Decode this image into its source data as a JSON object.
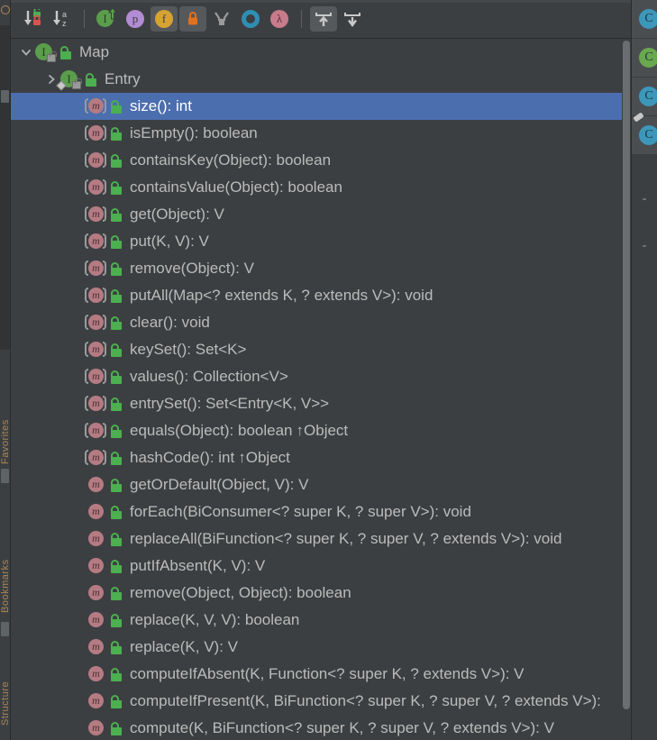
{
  "window": {
    "title": "Structure",
    "background": "#3c3f41",
    "selection_color": "#4b6eaf",
    "text_color": "#bbbbbb",
    "inherited_text_color": "#808080"
  },
  "toolbar": {
    "items": [
      {
        "name": "sort-by-visibility-button",
        "label": "Sort by Visibility",
        "icon": "sort-down-lock-icon",
        "active": false
      },
      {
        "name": "sort-alphabetically-button",
        "label": "Sort Alphabetically",
        "icon": "sort-down-az-icon",
        "active": false
      },
      {
        "separator": true
      },
      {
        "name": "show-inherited-button",
        "label": "Show Inherited",
        "icon": "interface-up-arrow-icon",
        "active": false,
        "color": "#5a9e4b"
      },
      {
        "name": "show-properties-button",
        "label": "Show Properties",
        "icon": "property-p-icon",
        "active": false,
        "color": "#b28cd4"
      },
      {
        "name": "show-fields-button",
        "label": "Show Fields",
        "icon": "field-f-icon",
        "active": true,
        "color": "#d6a332"
      },
      {
        "name": "show-non-public-button",
        "label": "Show Non-Public",
        "icon": "orange-padlock-icon",
        "active": true,
        "color": "#e2711d"
      },
      {
        "name": "show-anonymous-button",
        "label": "Show Anonymous Classes",
        "icon": "anonymous-y-icon",
        "active": false,
        "color": "#9a9a9a"
      },
      {
        "name": "show-interfaces-button",
        "label": "Show Interfaces",
        "icon": "ring-o-icon",
        "active": false,
        "color": "#2f8fb3"
      },
      {
        "name": "show-lambdas-button",
        "label": "Show Lambdas",
        "icon": "lambda-icon",
        "active": false,
        "color": "#c77b8b"
      },
      {
        "separator": true
      },
      {
        "name": "expand-all-button",
        "label": "Expand All",
        "icon": "expand-all-icon",
        "active": true
      },
      {
        "name": "collapse-all-button",
        "label": "Collapse All",
        "icon": "collapse-all-icon",
        "active": false
      }
    ]
  },
  "tree": {
    "rows": [
      {
        "name": "tree-node-map",
        "indent": 0,
        "arrow": "down",
        "icon": "interface-icon",
        "text": "Map",
        "selected": false
      },
      {
        "name": "tree-node-entry",
        "indent": 1,
        "arrow": "right",
        "icon": "interface-inner-icon",
        "text": "Entry",
        "selected": false
      },
      {
        "name": "tree-node-size",
        "indent": 2,
        "arrow": "none",
        "icon": "abstract-method-icon",
        "text": "size(): int",
        "selected": true
      },
      {
        "name": "tree-node-isempty",
        "indent": 2,
        "arrow": "none",
        "icon": "abstract-method-icon",
        "text": "isEmpty(): boolean",
        "selected": false
      },
      {
        "name": "tree-node-containskey",
        "indent": 2,
        "arrow": "none",
        "icon": "abstract-method-icon",
        "text": "containsKey(Object): boolean",
        "selected": false
      },
      {
        "name": "tree-node-containsvalue",
        "indent": 2,
        "arrow": "none",
        "icon": "abstract-method-icon",
        "text": "containsValue(Object): boolean",
        "selected": false
      },
      {
        "name": "tree-node-get",
        "indent": 2,
        "arrow": "none",
        "icon": "abstract-method-icon",
        "text": "get(Object): V",
        "selected": false
      },
      {
        "name": "tree-node-put",
        "indent": 2,
        "arrow": "none",
        "icon": "abstract-method-icon",
        "text": "put(K, V): V",
        "selected": false
      },
      {
        "name": "tree-node-remove",
        "indent": 2,
        "arrow": "none",
        "icon": "abstract-method-icon",
        "text": "remove(Object): V",
        "selected": false
      },
      {
        "name": "tree-node-putall",
        "indent": 2,
        "arrow": "none",
        "icon": "abstract-method-icon",
        "text": "putAll(Map<? extends K, ? extends V>): void",
        "selected": false
      },
      {
        "name": "tree-node-clear",
        "indent": 2,
        "arrow": "none",
        "icon": "abstract-method-icon",
        "text": "clear(): void",
        "selected": false
      },
      {
        "name": "tree-node-keyset",
        "indent": 2,
        "arrow": "none",
        "icon": "abstract-method-icon",
        "text": "keySet(): Set<K>",
        "selected": false
      },
      {
        "name": "tree-node-values",
        "indent": 2,
        "arrow": "none",
        "icon": "abstract-method-icon",
        "text": "values(): Collection<V>",
        "selected": false
      },
      {
        "name": "tree-node-entryset",
        "indent": 2,
        "arrow": "none",
        "icon": "abstract-method-icon",
        "text": "entrySet(): Set<Entry<K, V>>",
        "selected": false
      },
      {
        "name": "tree-node-equals",
        "indent": 2,
        "arrow": "none",
        "icon": "abstract-method-icon",
        "text": "equals(Object): boolean",
        "inherited": "↑Object",
        "selected": false
      },
      {
        "name": "tree-node-hashcode",
        "indent": 2,
        "arrow": "none",
        "icon": "abstract-method-icon",
        "text": "hashCode(): int",
        "inherited": "↑Object",
        "selected": false
      },
      {
        "name": "tree-node-getordefault",
        "indent": 2,
        "arrow": "none",
        "icon": "method-icon",
        "text": "getOrDefault(Object, V): V",
        "selected": false
      },
      {
        "name": "tree-node-foreach",
        "indent": 2,
        "arrow": "none",
        "icon": "method-icon",
        "text": "forEach(BiConsumer<? super K, ? super V>): void",
        "selected": false
      },
      {
        "name": "tree-node-replaceall",
        "indent": 2,
        "arrow": "none",
        "icon": "method-icon",
        "text": "replaceAll(BiFunction<? super K, ? super V, ? extends V>): void",
        "selected": false
      },
      {
        "name": "tree-node-putifabsent",
        "indent": 2,
        "arrow": "none",
        "icon": "method-icon",
        "text": "putIfAbsent(K, V): V",
        "selected": false
      },
      {
        "name": "tree-node-remove2",
        "indent": 2,
        "arrow": "none",
        "icon": "method-icon",
        "text": "remove(Object, Object): boolean",
        "selected": false
      },
      {
        "name": "tree-node-replace3",
        "indent": 2,
        "arrow": "none",
        "icon": "method-icon",
        "text": "replace(K, V, V): boolean",
        "selected": false
      },
      {
        "name": "tree-node-replace2",
        "indent": 2,
        "arrow": "none",
        "icon": "method-icon",
        "text": "replace(K, V): V",
        "selected": false
      },
      {
        "name": "tree-node-computeifabsent",
        "indent": 2,
        "arrow": "none",
        "icon": "method-icon",
        "text": "computeIfAbsent(K, Function<? super K, ? extends V>): V",
        "selected": false
      },
      {
        "name": "tree-node-computeifpresent",
        "indent": 2,
        "arrow": "none",
        "icon": "method-icon",
        "text": "computeIfPresent(K, BiFunction<? super K, ? super V, ? extends V>):",
        "selected": false
      },
      {
        "name": "tree-node-compute",
        "indent": 2,
        "arrow": "none",
        "icon": "method-icon",
        "text": "compute(K, BiFunction<? super K, ? super V, ? extends V>): V",
        "selected": false
      }
    ]
  },
  "right_strip": {
    "items": [
      {
        "name": "right-tool-1",
        "icon": "blue-circle-icon",
        "color": "#3d97bb"
      },
      {
        "name": "right-tool-2",
        "icon": "green-circle-icon",
        "color": "#6aa84f"
      },
      {
        "name": "right-tool-3",
        "icon": "blue-circle-icon",
        "color": "#3d97bb"
      },
      {
        "name": "right-tool-4",
        "icon": "blue-circle-clip-icon",
        "color": "#3d97bb"
      }
    ]
  },
  "left_strip": {
    "labels": [
      "Favorites",
      "Bookmarks",
      "Structure"
    ]
  },
  "scrollbar": {
    "name": "vertical-scrollbar",
    "thumb_ratio": 0.95
  }
}
